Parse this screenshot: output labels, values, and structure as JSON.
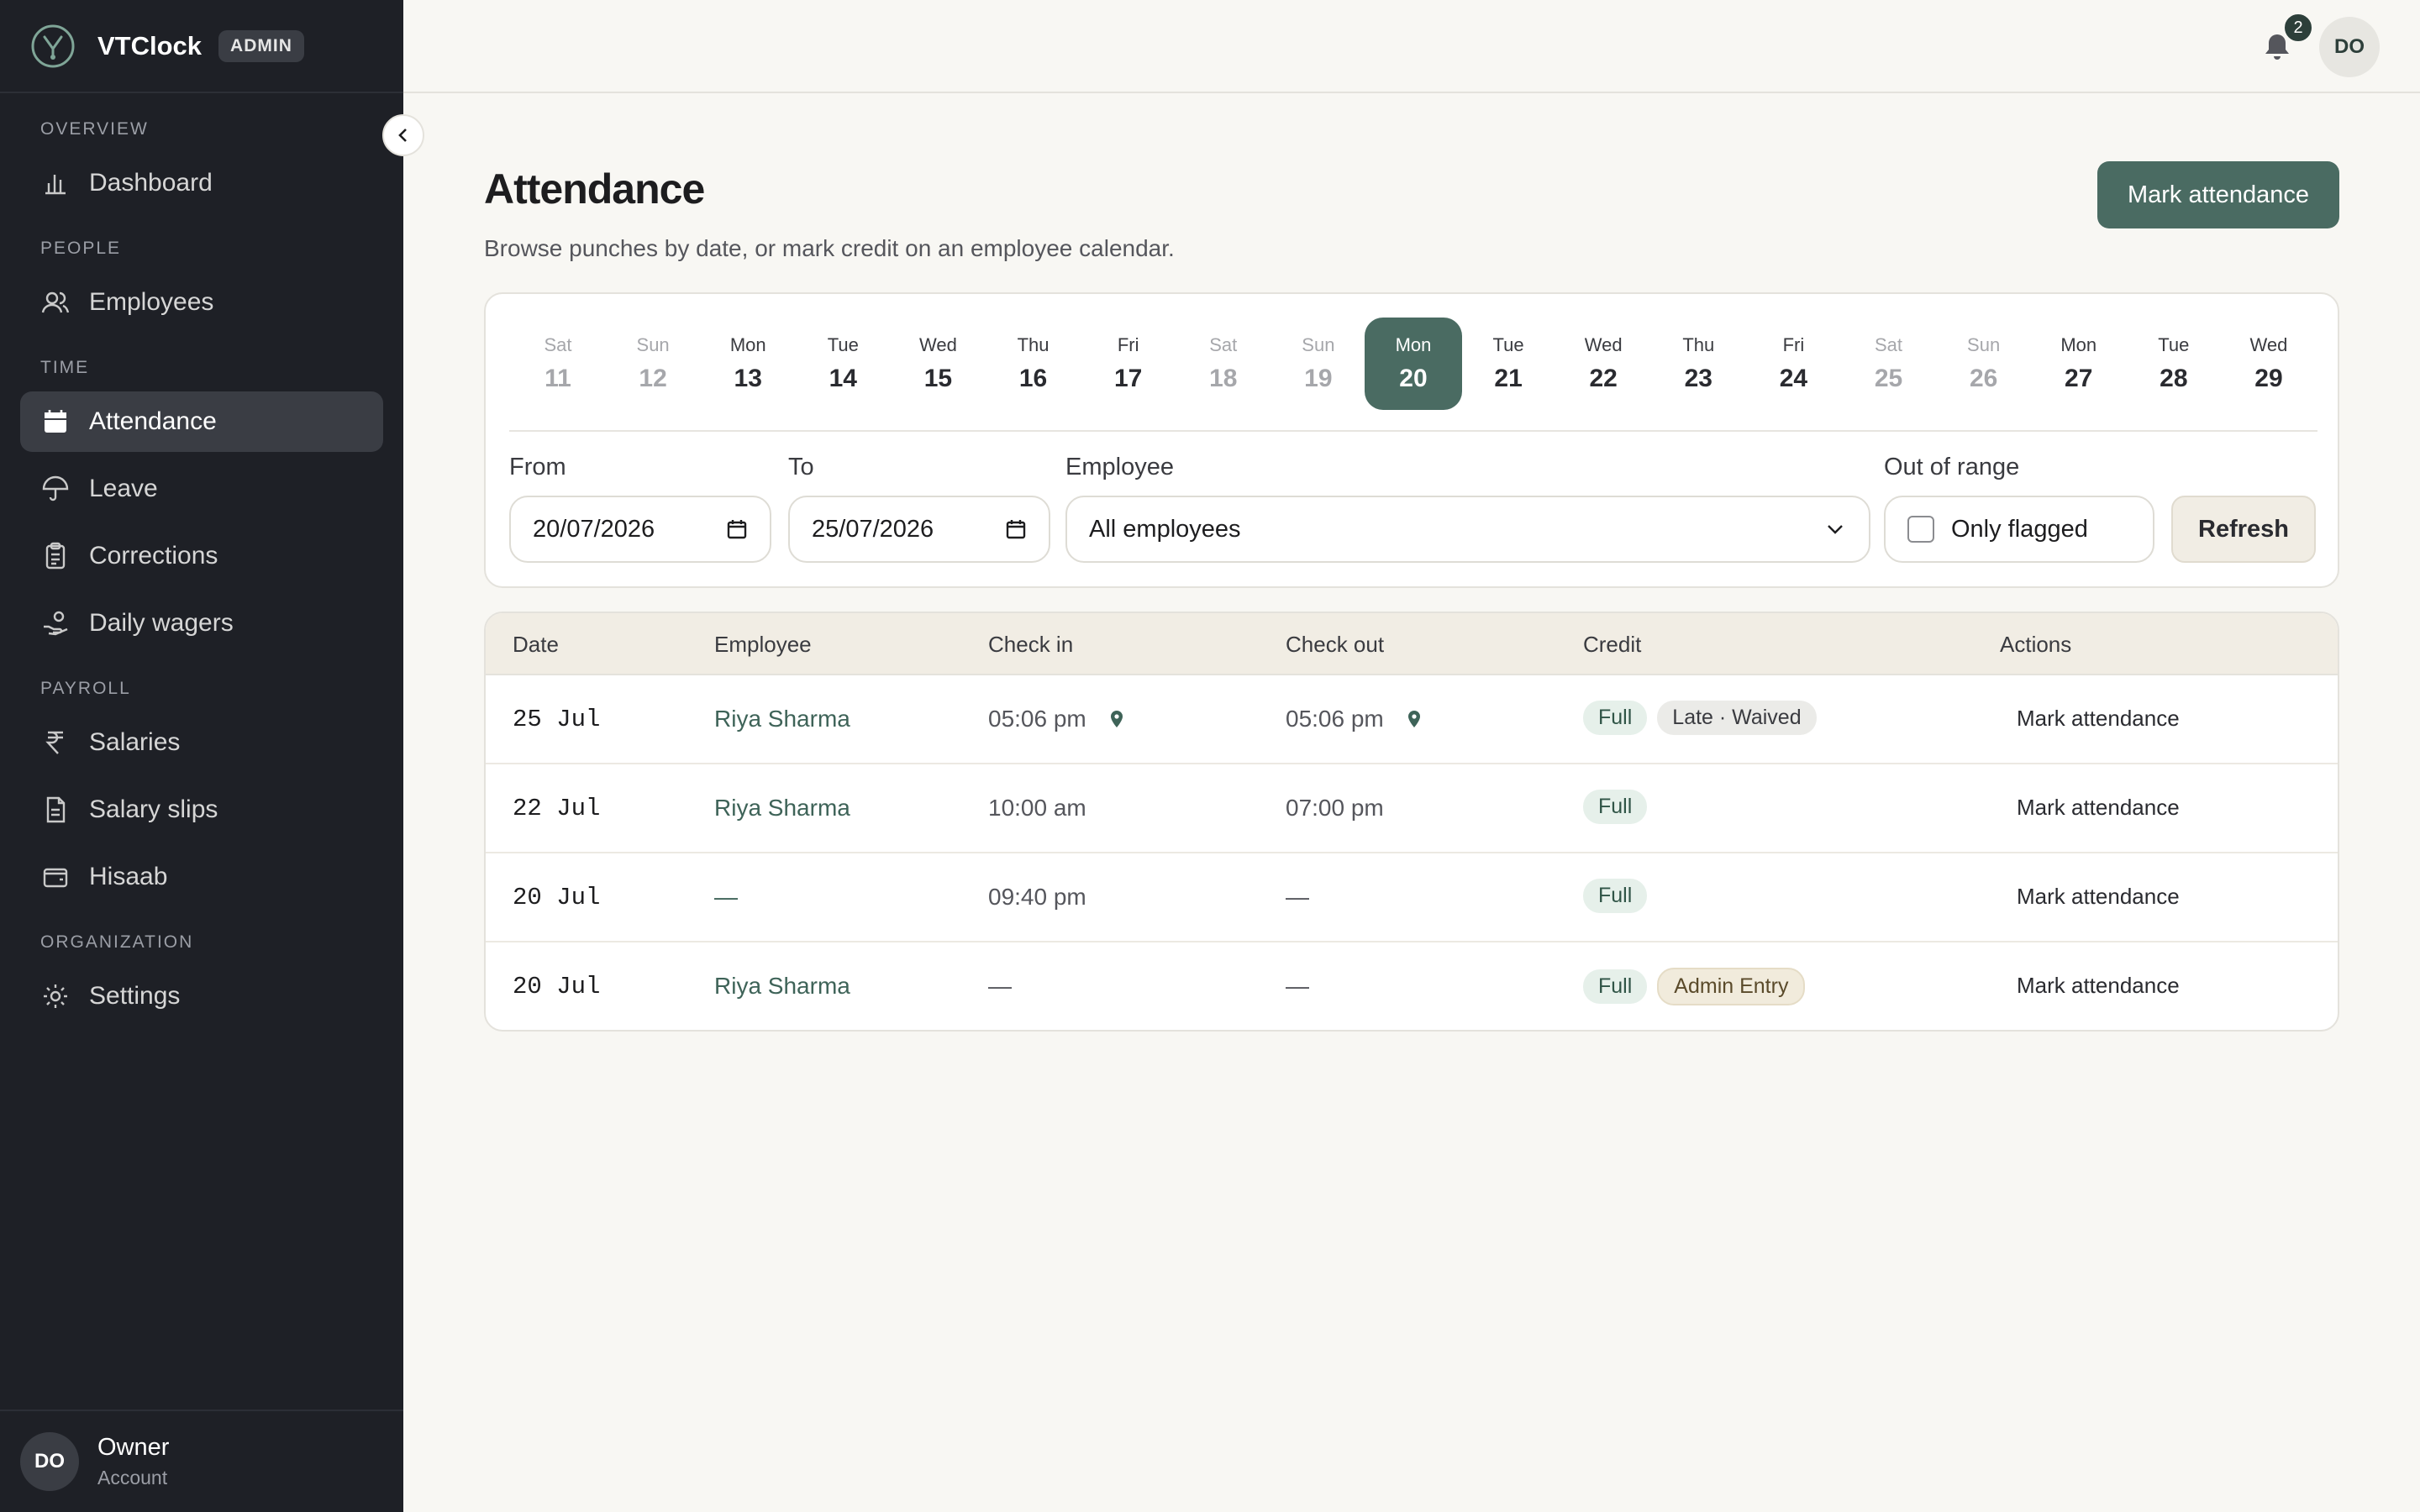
{
  "brand": {
    "name": "VTClock",
    "badge": "ADMIN"
  },
  "sidebar": {
    "sections": [
      {
        "title": "OVERVIEW",
        "items": [
          {
            "label": "Dashboard",
            "icon": "bar-chart-icon"
          }
        ]
      },
      {
        "title": "PEOPLE",
        "items": [
          {
            "label": "Employees",
            "icon": "users-icon"
          }
        ]
      },
      {
        "title": "TIME",
        "items": [
          {
            "label": "Attendance",
            "icon": "calendar-icon",
            "active": true
          },
          {
            "label": "Leave",
            "icon": "umbrella-icon"
          },
          {
            "label": "Corrections",
            "icon": "clipboard-icon"
          },
          {
            "label": "Daily wagers",
            "icon": "hand-coins-icon"
          }
        ]
      },
      {
        "title": "PAYROLL",
        "items": [
          {
            "label": "Salaries",
            "icon": "rupee-icon"
          },
          {
            "label": "Salary slips",
            "icon": "file-icon"
          },
          {
            "label": "Hisaab",
            "icon": "wallet-icon"
          }
        ]
      },
      {
        "title": "ORGANIZATION",
        "items": [
          {
            "label": "Settings",
            "icon": "gear-icon"
          }
        ]
      }
    ],
    "footer": {
      "initials": "DO",
      "name": "Owner",
      "sub": "Account"
    }
  },
  "topbar": {
    "notifications": "2",
    "initials": "DO"
  },
  "page": {
    "title": "Attendance",
    "subtitle": "Browse punches by date, or mark credit on an employee calendar.",
    "primary_button": "Mark attendance"
  },
  "days": [
    {
      "name": "Sat",
      "num": "11",
      "weekend": true
    },
    {
      "name": "Sun",
      "num": "12",
      "weekend": true
    },
    {
      "name": "Mon",
      "num": "13"
    },
    {
      "name": "Tue",
      "num": "14"
    },
    {
      "name": "Wed",
      "num": "15"
    },
    {
      "name": "Thu",
      "num": "16"
    },
    {
      "name": "Fri",
      "num": "17"
    },
    {
      "name": "Sat",
      "num": "18",
      "weekend": true
    },
    {
      "name": "Sun",
      "num": "19",
      "weekend": true
    },
    {
      "name": "Mon",
      "num": "20",
      "selected": true
    },
    {
      "name": "Tue",
      "num": "21"
    },
    {
      "name": "Wed",
      "num": "22"
    },
    {
      "name": "Thu",
      "num": "23"
    },
    {
      "name": "Fri",
      "num": "24"
    },
    {
      "name": "Sat",
      "num": "25",
      "weekend": true
    },
    {
      "name": "Sun",
      "num": "26",
      "weekend": true
    },
    {
      "name": "Mon",
      "num": "27"
    },
    {
      "name": "Tue",
      "num": "28"
    },
    {
      "name": "Wed",
      "num": "29"
    }
  ],
  "filters": {
    "from_label": "From",
    "from_value": "20/07/2026",
    "to_label": "To",
    "to_value": "25/07/2026",
    "employee_label": "Employee",
    "employee_value": "All employees",
    "range_label": "Out of range",
    "range_value": "Only flagged",
    "refresh": "Refresh"
  },
  "table": {
    "headers": [
      "Date",
      "Employee",
      "Check in",
      "Check out",
      "Credit",
      "Actions"
    ],
    "rows": [
      {
        "date": "25 Jul",
        "employee": "Riya Sharma",
        "check_in": "05:06 pm",
        "check_in_pin": true,
        "check_out": "05:06 pm",
        "check_out_pin": true,
        "credit": "Full",
        "tag": "Late · Waived",
        "tag_style": "gray",
        "action": "Mark attendance"
      },
      {
        "date": "22 Jul",
        "employee": "Riya Sharma",
        "check_in": "10:00 am",
        "check_out": "07:00 pm",
        "credit": "Full",
        "tag": "",
        "action": "Mark attendance"
      },
      {
        "date": "20 Jul",
        "employee": "—",
        "check_in": "09:40 pm",
        "check_out": "—",
        "credit": "Full",
        "tag": "",
        "action": "Mark attendance"
      },
      {
        "date": "20 Jul",
        "employee": "Riya Sharma",
        "check_in": "—",
        "check_out": "—",
        "credit": "Full",
        "tag": "Admin Entry",
        "tag_style": "tan",
        "action": "Mark attendance"
      }
    ]
  },
  "colors": {
    "accent": "#4a6b62",
    "sidebar": "#1e2026",
    "background": "#f8f7f3"
  }
}
